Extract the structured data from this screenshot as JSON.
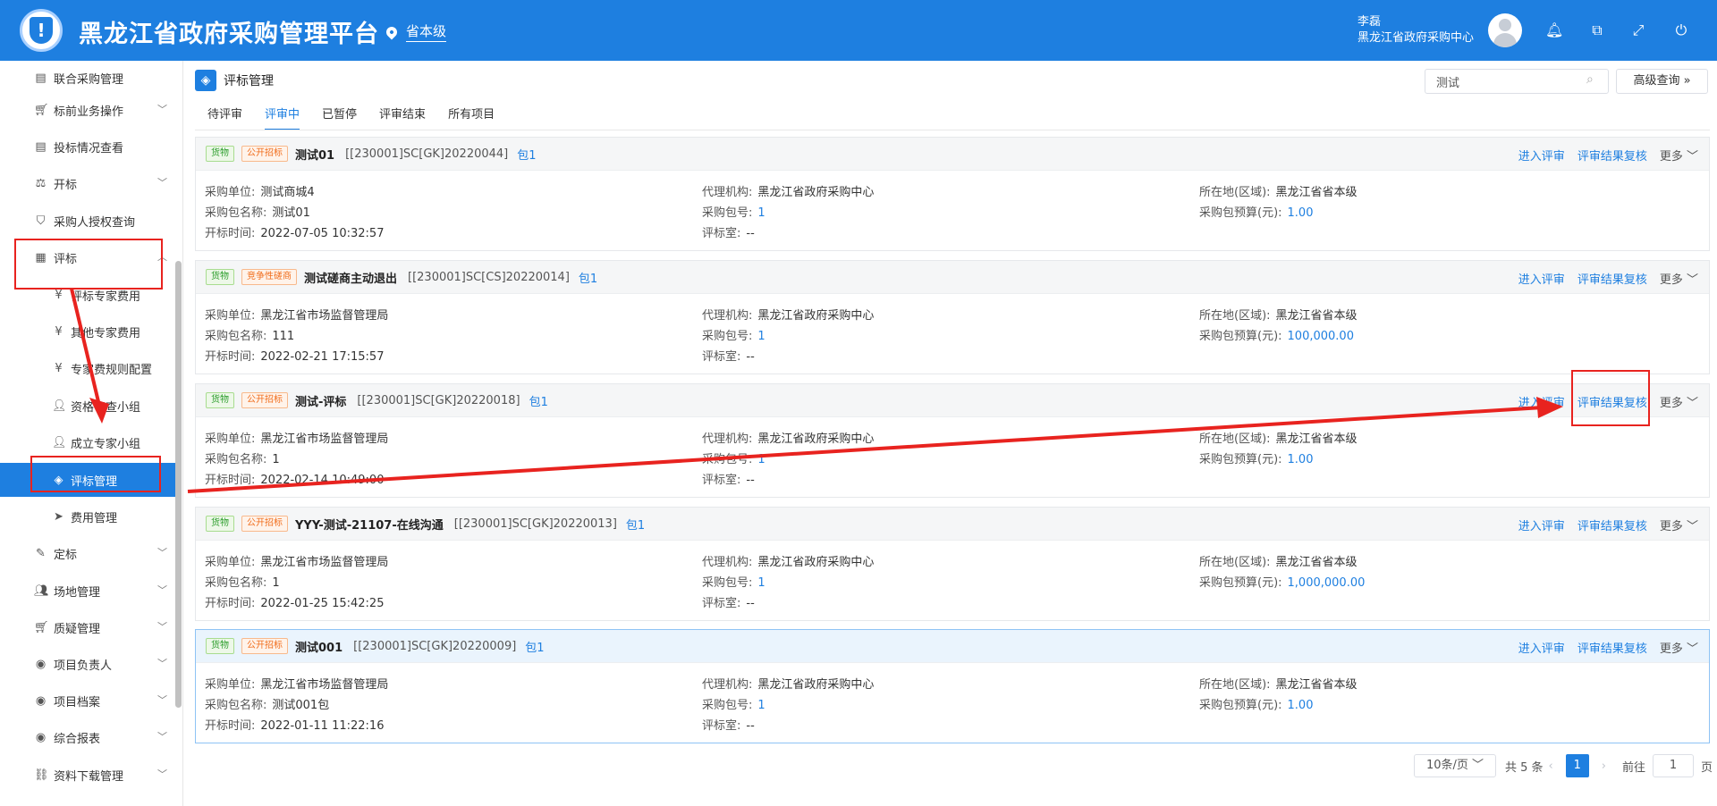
{
  "header": {
    "title": "黑龙江省政府采购管理平台",
    "region": "省本级",
    "user_name": "李磊",
    "user_org": "黑龙江省政府采购中心"
  },
  "sidebar": {
    "items": [
      {
        "label": "联合采购管理",
        "icon": "document-icon"
      },
      {
        "label": "标前业务操作",
        "icon": "cart-icon"
      },
      {
        "label": "投标情况查看",
        "icon": "document-icon"
      },
      {
        "label": "开标",
        "icon": "gavel-icon"
      },
      {
        "label": "采购人授权查询",
        "icon": "shield-icon"
      },
      {
        "label": "评标",
        "icon": "calendar-icon"
      },
      {
        "label": "评标专家费用",
        "icon": "yen-icon"
      },
      {
        "label": "其他专家费用",
        "icon": "yen-icon"
      },
      {
        "label": "专家费规则配置",
        "icon": "yen-icon"
      },
      {
        "label": "资格审查小组",
        "icon": "user-icon"
      },
      {
        "label": "成立专家小组",
        "icon": "user-icon"
      },
      {
        "label": "评标管理",
        "icon": "layers-icon"
      },
      {
        "label": "费用管理",
        "icon": "send-icon"
      },
      {
        "label": "定标",
        "icon": "edit-icon"
      },
      {
        "label": "场地管理",
        "icon": "users-icon"
      },
      {
        "label": "质疑管理",
        "icon": "cart-icon"
      },
      {
        "label": "项目负责人",
        "icon": "person-circle-icon"
      },
      {
        "label": "项目档案",
        "icon": "person-circle-icon"
      },
      {
        "label": "综合报表",
        "icon": "person-circle-icon"
      },
      {
        "label": "资料下载管理",
        "icon": "link-icon"
      }
    ]
  },
  "page": {
    "title": "评标管理",
    "search_value": "测试",
    "advanced": "高级查询",
    "tabs": [
      "待评审",
      "评审中",
      "已暂停",
      "评审结束",
      "所有项目"
    ]
  },
  "labels": {
    "unit": "采购单位:",
    "pkg_name": "采购包名称:",
    "open_time": "开标时间:",
    "agency": "代理机构:",
    "pkg_no": "采购包号:",
    "room": "评标室:",
    "region": "所在地(区域):",
    "budget": "采购包预算(元):",
    "enter": "进入评审",
    "recheck": "评审结果复核",
    "more": "更多"
  },
  "cards": [
    {
      "tag1": "货物",
      "tag2": "公开招标",
      "title": "测试01",
      "code": "[[230001]SC[GK]20220044]",
      "pkg": "包1",
      "unit": "测试商城4",
      "pkg_name": "测试01",
      "open_time": "2022-07-05 10:32:57",
      "agency": "黑龙江省政府采购中心",
      "pkg_no": "1",
      "room": "--",
      "region": "黑龙江省省本级",
      "budget": "1.00"
    },
    {
      "tag1": "货物",
      "tag2": "竞争性磋商",
      "title": "测试磋商主动退出",
      "code": "[[230001]SC[CS]20220014]",
      "pkg": "包1",
      "unit": "黑龙江省市场监督管理局",
      "pkg_name": "111",
      "open_time": "2022-02-21 17:15:57",
      "agency": "黑龙江省政府采购中心",
      "pkg_no": "1",
      "room": "--",
      "region": "黑龙江省省本级",
      "budget": "100,000.00"
    },
    {
      "tag1": "货物",
      "tag2": "公开招标",
      "title": "测试-评标",
      "code": "[[230001]SC[GK]20220018]",
      "pkg": "包1",
      "unit": "黑龙江省市场监督管理局",
      "pkg_name": "1",
      "open_time": "2022-02-14 10:49:00",
      "agency": "黑龙江省政府采购中心",
      "pkg_no": "1",
      "room": "--",
      "region": "黑龙江省省本级",
      "budget": "1.00"
    },
    {
      "tag1": "货物",
      "tag2": "公开招标",
      "title": "YYY-测试-21107-在线沟通",
      "code": "[[230001]SC[GK]20220013]",
      "pkg": "包1",
      "unit": "黑龙江省市场监督管理局",
      "pkg_name": "1",
      "open_time": "2022-01-25 15:42:25",
      "agency": "黑龙江省政府采购中心",
      "pkg_no": "1",
      "room": "--",
      "region": "黑龙江省省本级",
      "budget": "1,000,000.00"
    },
    {
      "tag1": "货物",
      "tag2": "公开招标",
      "title": "测试001",
      "code": "[[230001]SC[GK]20220009]",
      "pkg": "包1",
      "unit": "黑龙江省市场监督管理局",
      "pkg_name": "测试001包",
      "open_time": "2022-01-11 11:22:16",
      "agency": "黑龙江省政府采购中心",
      "pkg_no": "1",
      "room": "--",
      "region": "黑龙江省省本级",
      "budget": "1.00"
    }
  ],
  "pager": {
    "page_size": "10条/页",
    "total": "共 5 条",
    "current": "1",
    "goto_label": "前往",
    "goto_value": "1",
    "page_suffix": "页"
  },
  "colors": {
    "brand": "#1e7fe0",
    "annotation": "#e8231f"
  }
}
